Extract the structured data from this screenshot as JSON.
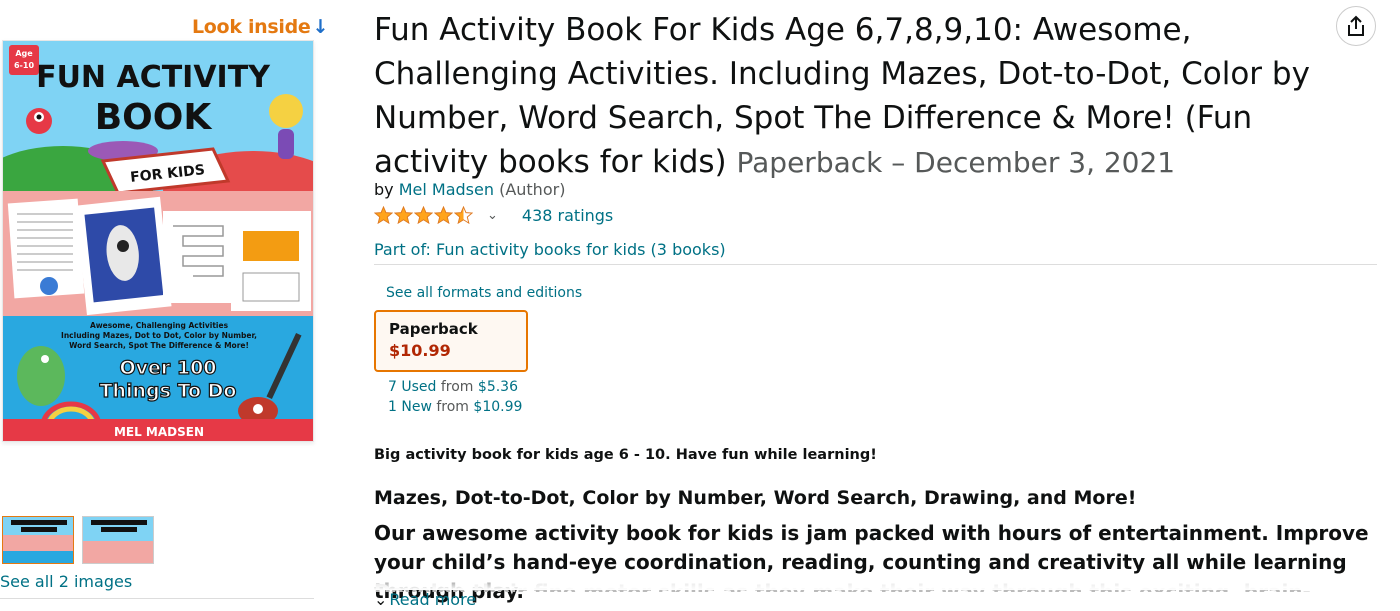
{
  "look_inside": {
    "label": "Look inside",
    "arrow": "↓"
  },
  "cover": {
    "age_badge": "Age 6-10",
    "age_line1": "Age",
    "age_line2": "6-10",
    "title_line1": "FUN ACTIVITY",
    "title_line2": "BOOK",
    "ribbon": "FOR KIDS",
    "blurb_line1": "Awesome, Challenging Activities",
    "blurb_line2": "Including Mazes, Dot to Dot, Color by Number,",
    "blurb_line3": "Word Search, Spot The Difference & More!",
    "big_line1": "Over 100",
    "big_line2": "Things To Do",
    "author": "MEL MADSEN"
  },
  "gallery": {
    "see_all_label": "See all 2 images",
    "thumbnails": [
      "front-cover-thumbnail",
      "back-cover-thumbnail"
    ]
  },
  "product": {
    "title": "Fun Activity Book For Kids Age 6,7,8,9,10: Awesome, Challenging Activities. Including Mazes, Dot-to-Dot, Color by Number, Word Search, Spot The Difference & More! (Fun activity books for kids)",
    "format_date": "Paperback – December 3, 2021",
    "by_label": "by",
    "author": "Mel Madsen",
    "author_role": "(Author)",
    "rating": 4.5,
    "ratings_count": "438 ratings",
    "series_label": "Part of: Fun activity books for kids (3 books)"
  },
  "formats": {
    "see_all_label": "See all formats and editions",
    "selected": {
      "name": "Paperback",
      "price": "$10.99"
    },
    "used_label": "7 Used",
    "used_price": "$5.36",
    "new_label": "1 New",
    "new_price": "$10.99",
    "from_label": "from"
  },
  "description": {
    "lead": "Big activity book for kids age 6 - 10. Have fun while learning!",
    "heading": "Mazes, Dot-to-Dot, Color by Number, Word Search, Drawing, and More!",
    "body": "Our awesome activity book for kids is jam packed with hours of entertainment. Improve your child’s hand-eye coordination, reading, counting and creativity all while learning through play.",
    "faded": "Develop their fine motor skills as they make their way through this exciting, brain-stimulating",
    "read_more_label": "Read more"
  },
  "icons": {
    "share": "share-icon",
    "star": "star-icon",
    "chevron": "chevron-down-icon"
  },
  "colors": {
    "link": "#007185",
    "price": "#B12704",
    "accent": "#E77600",
    "star": "#FFA41C"
  }
}
